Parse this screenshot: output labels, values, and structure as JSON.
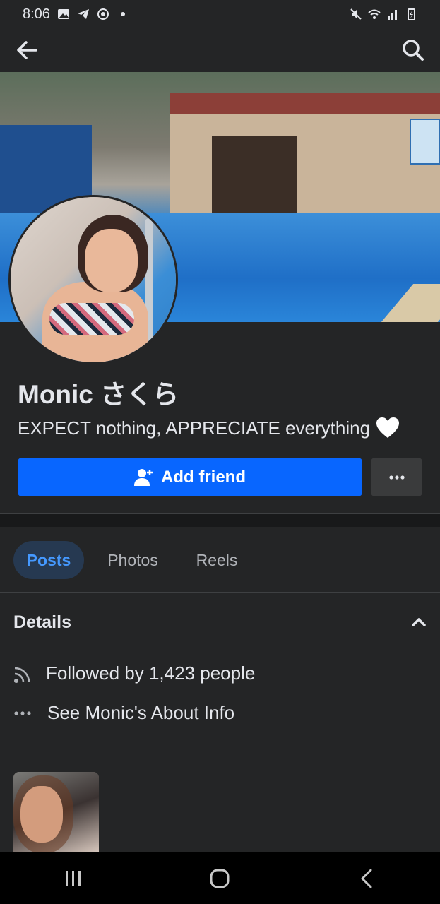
{
  "status_bar": {
    "time": "8:06",
    "icons_left": [
      "gallery-icon",
      "telegram-icon",
      "sync-icon",
      "dot-icon"
    ],
    "icons_right": [
      "mute-icon",
      "wifi-icon",
      "signal-icon",
      "battery-icon"
    ]
  },
  "app_bar": {
    "back_icon": "arrow-left-icon",
    "search_icon": "search-icon"
  },
  "profile": {
    "name": "Monic さくら",
    "bio": "EXPECT nothing, APPRECIATE everything",
    "bio_emoji": "white-heart"
  },
  "actions": {
    "add_friend_label": "Add friend",
    "more_icon": "ellipsis-icon"
  },
  "tabs": [
    {
      "label": "Posts",
      "active": true
    },
    {
      "label": "Photos",
      "active": false
    },
    {
      "label": "Reels",
      "active": false
    }
  ],
  "details": {
    "title": "Details",
    "items": [
      {
        "icon": "rss-icon",
        "text": "Followed by 1,423 people"
      },
      {
        "icon": "ellipsis-icon",
        "text": "See Monic's About Info"
      }
    ]
  },
  "colors": {
    "background": "#242526",
    "primary_button": "#0866ff",
    "active_tab_bg": "#263951",
    "active_tab_text": "#4599ff"
  },
  "nav_bar": [
    "recent-apps-icon",
    "home-icon",
    "back-icon"
  ]
}
